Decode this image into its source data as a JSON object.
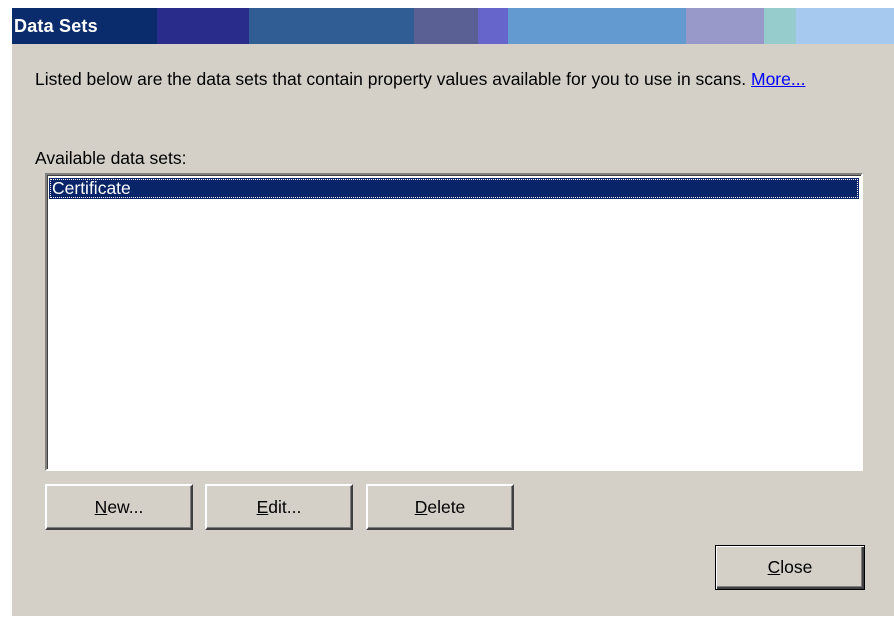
{
  "window": {
    "title": "Data Sets",
    "title_colors": [
      "#0b2c6c",
      "#2a2c8c",
      "#2f5d94",
      "#5a5f94",
      "#6665cc",
      "#639ad0",
      "#9999c9",
      "#96cccc",
      "#a6c9ef"
    ]
  },
  "description": {
    "text": "Listed below are the data sets that contain property values available for you to use in scans.",
    "link": "More..."
  },
  "list": {
    "label": "Available data sets:",
    "items": [
      {
        "label": "Certificate",
        "selected": true
      }
    ]
  },
  "buttons": {
    "new": {
      "mnemonic": "N",
      "rest": "ew..."
    },
    "edit": {
      "mnemonic": "E",
      "rest": "dit..."
    },
    "delete": {
      "mnemonic": "D",
      "rest": "elete"
    },
    "close": {
      "mnemonic": "C",
      "rest": "lose"
    }
  }
}
